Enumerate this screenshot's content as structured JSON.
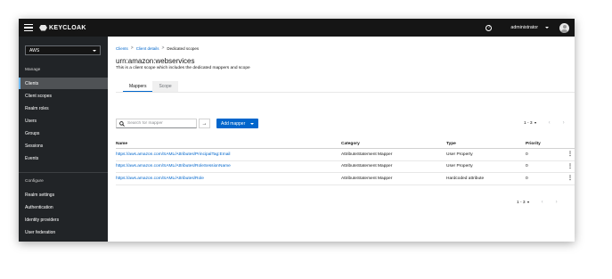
{
  "header": {
    "logo_text": "KEYCLOAK",
    "help_icon": "help-circle-icon",
    "user_name": "administrator"
  },
  "sidebar": {
    "realm": "AWS",
    "groups": [
      {
        "title": "Manage",
        "items": [
          {
            "label": "Clients",
            "active": true
          },
          {
            "label": "Client scopes"
          },
          {
            "label": "Realm roles"
          },
          {
            "label": "Users"
          },
          {
            "label": "Groups"
          },
          {
            "label": "Sessions"
          },
          {
            "label": "Events"
          }
        ]
      },
      {
        "title": "Configure",
        "items": [
          {
            "label": "Realm settings"
          },
          {
            "label": "Authentication"
          },
          {
            "label": "Identity providers"
          },
          {
            "label": "User federation"
          }
        ]
      }
    ]
  },
  "breadcrumb": {
    "items": [
      "Clients",
      "Client details",
      "Dedicated scopes"
    ],
    "separator": ">"
  },
  "page": {
    "title": "urn:amazon:webservices",
    "description": "This is a client scope which includes the dedicated mappers and scope"
  },
  "tabs": [
    {
      "label": "Mappers",
      "active": true
    },
    {
      "label": "Scope",
      "active": false
    }
  ],
  "toolbar": {
    "search_placeholder": "Search for mapper",
    "search_go": "→",
    "add_mapper_label": "Add mapper"
  },
  "pagination": {
    "range": "1 - 3",
    "prev": "‹",
    "next": "›"
  },
  "table": {
    "columns": [
      "Name",
      "Category",
      "Type",
      "Priority"
    ],
    "rows": [
      {
        "name": "https://aws.amazon.com/SAML/Attributes/PrincipalTag:Email",
        "category": "AttributeStatement Mapper",
        "type": "User Property",
        "priority": "0"
      },
      {
        "name": "https://aws.amazon.com/SAML/Attributes/RoleSessionName",
        "category": "AttributeStatement Mapper",
        "type": "User Property",
        "priority": "0"
      },
      {
        "name": "https://aws.amazon.com/SAML/Attributes/Role",
        "category": "AttributeStatement Mapper",
        "type": "Hardcoded attribute",
        "priority": "0"
      }
    ],
    "kebab": "⋮"
  },
  "colors": {
    "topbar": "#151515",
    "sidebar": "#212427",
    "accent": "#0066cc",
    "active_nav": "#4f5255"
  }
}
